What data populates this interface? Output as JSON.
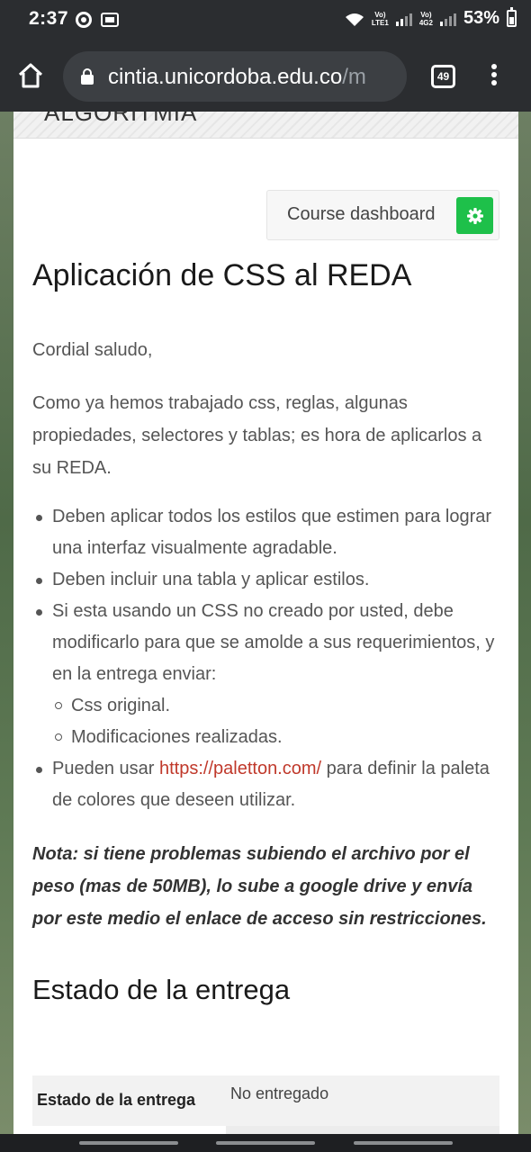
{
  "status_bar": {
    "time": "2:37",
    "lte_label_top": "Vo)",
    "lte_label_bottom": "LTE1",
    "g_label_top": "Vo)",
    "g_label_bottom": "4G2",
    "battery": "53%"
  },
  "browser": {
    "url_domain": "cintia.unicordoba.edu.co",
    "url_rest": "/m",
    "tab_count": "49"
  },
  "page": {
    "header_partial_title": "ALGORITMIA",
    "dashboard_button": "Course dashboard",
    "title": "Aplicación de CSS al REDA",
    "greeting": "Cordial saludo,",
    "intro": "Como ya hemos trabajado css, reglas, algunas propiedades, selectores y tablas; es hora de aplicarlos a su REDA.",
    "bullets": [
      "Deben aplicar todos los estilos que estimen para lograr una interfaz visualmente agradable.",
      "Deben incluir una tabla y aplicar estilos.",
      "Si esta usando un CSS no creado por usted, debe modificarlo para que se amolde a sus requerimientos, y en la entrega enviar:"
    ],
    "sub_bullets": [
      "Css original.",
      "Modificaciones realizadas."
    ],
    "last_bullet_prefix": "Pueden usar ",
    "last_bullet_link": "https://paletton.com/",
    "last_bullet_suffix": " para definir la paleta de colores que deseen utilizar.",
    "note": "Nota: si tiene problemas subiendo el archivo por el peso (mas de 50MB), lo sube a google drive y envía por este medio el enlace de acceso sin restricciones.",
    "section_title": "Estado de la entrega",
    "status_row_label": "Estado de la entrega",
    "status_row_value": "No entregado"
  },
  "colors": {
    "gear_button": "#1ec04a",
    "link": "#c0392b",
    "chrome_bar": "#2b2d30"
  }
}
